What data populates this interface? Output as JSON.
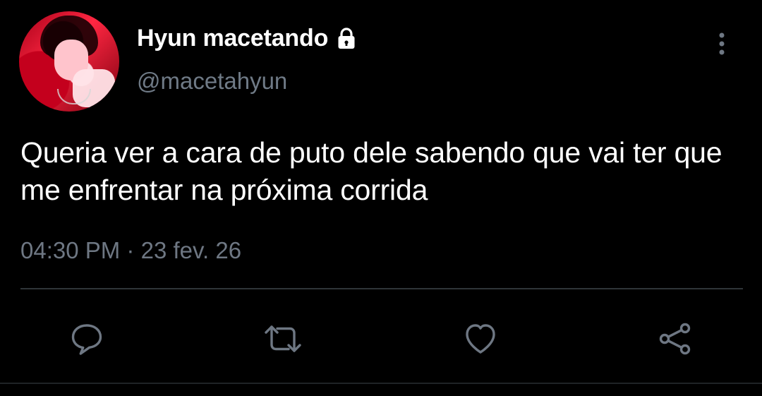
{
  "tweet": {
    "author": {
      "display_name": "Hyun macetando",
      "handle": "@macetahyun",
      "avatar": "profile-photo",
      "protected_icon": "lock-icon"
    },
    "text": "Queria ver a cara de puto dele sabendo que vai ter que me enfrentar na próxima corrida",
    "time": "04:30 PM",
    "separator": "·",
    "date": "23 fev. 26",
    "menu_icon": "vertical-more-icon",
    "actions": [
      {
        "name": "reply",
        "icon": "reply-icon"
      },
      {
        "name": "retweet",
        "icon": "retweet-icon"
      },
      {
        "name": "like",
        "icon": "heart-icon"
      },
      {
        "name": "share",
        "icon": "share-icon"
      }
    ]
  },
  "colors": {
    "background": "#000000",
    "primary_text": "#ffffff",
    "secondary_text": "#6e7783",
    "icon": "#6e7783",
    "divider": "#2f3438"
  }
}
